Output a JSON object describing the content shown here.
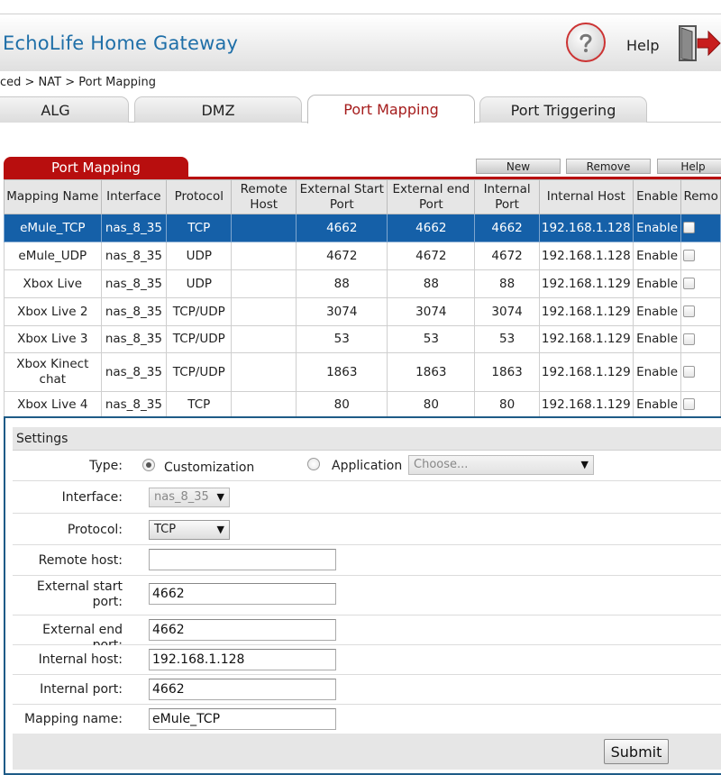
{
  "header": {
    "brand": "EchoLife Home Gateway",
    "help_label": "Help"
  },
  "breadcrumb": "ced > NAT > Port Mapping",
  "tabs": [
    {
      "label": "ALG",
      "active": false
    },
    {
      "label": "DMZ",
      "active": false
    },
    {
      "label": "Port Mapping",
      "active": true
    },
    {
      "label": "Port Triggering",
      "active": false
    }
  ],
  "section": {
    "title": "Port Mapping",
    "buttons": {
      "new": "New",
      "remove": "Remove",
      "help": "Help"
    }
  },
  "table": {
    "headers": {
      "mapping_name": "Mapping Name",
      "interface": "Interface",
      "protocol": "Protocol",
      "remote_host_1": "Remote",
      "remote_host_2": "Host",
      "ext_start_1": "External Start",
      "ext_start_2": "Port",
      "ext_end_1": "External end",
      "ext_end_2": "Port",
      "int_port_1": "Internal",
      "int_port_2": "Port",
      "internal_host": "Internal Host",
      "enable": "Enable",
      "remove": "Remo"
    },
    "rows": [
      {
        "name": "eMule_TCP",
        "iface": "nas_8_35",
        "proto": "TCP",
        "remote": "",
        "ext_start": "4662",
        "ext_end": "4662",
        "int_port": "4662",
        "host": "192.168.1.128",
        "enable": "Enable"
      },
      {
        "name": "eMule_UDP",
        "iface": "nas_8_35",
        "proto": "UDP",
        "remote": "",
        "ext_start": "4672",
        "ext_end": "4672",
        "int_port": "4672",
        "host": "192.168.1.128",
        "enable": "Enable"
      },
      {
        "name": "Xbox Live",
        "iface": "nas_8_35",
        "proto": "UDP",
        "remote": "",
        "ext_start": "88",
        "ext_end": "88",
        "int_port": "88",
        "host": "192.168.1.129",
        "enable": "Enable"
      },
      {
        "name": "Xbox Live 2",
        "iface": "nas_8_35",
        "proto": "TCP/UDP",
        "remote": "",
        "ext_start": "3074",
        "ext_end": "3074",
        "int_port": "3074",
        "host": "192.168.1.129",
        "enable": "Enable"
      },
      {
        "name": "Xbox Live 3",
        "iface": "nas_8_35",
        "proto": "TCP/UDP",
        "remote": "",
        "ext_start": "53",
        "ext_end": "53",
        "int_port": "53",
        "host": "192.168.1.129",
        "enable": "Enable"
      },
      {
        "name_1": "Xbox Kinect",
        "name_2": "chat",
        "iface": "nas_8_35",
        "proto": "TCP/UDP",
        "remote": "",
        "ext_start": "1863",
        "ext_end": "1863",
        "int_port": "1863",
        "host": "192.168.1.129",
        "enable": "Enable"
      },
      {
        "name": "Xbox Live 4",
        "iface": "nas_8_35",
        "proto": "TCP",
        "remote": "",
        "ext_start": "80",
        "ext_end": "80",
        "int_port": "80",
        "host": "192.168.1.129",
        "enable": "Enable"
      }
    ]
  },
  "settings": {
    "title": "Settings",
    "type_label": "Type:",
    "type_customization": "Customization",
    "type_application": "Application",
    "application_select": "Choose...",
    "interface_label": "Interface:",
    "interface_value": "nas_8_35",
    "protocol_label": "Protocol:",
    "protocol_value": "TCP",
    "remote_host_label": "Remote host:",
    "remote_host_value": "",
    "ext_start_label_1": "External start",
    "ext_start_label_2": "port:",
    "ext_start_value": "4662",
    "ext_end_label": "External end port:",
    "ext_end_value": "4662",
    "internal_host_label": "Internal host:",
    "internal_host_value": "192.168.1.128",
    "internal_port_label": "Internal port:",
    "internal_port_value": "4662",
    "mapping_name_label": "Mapping name:",
    "mapping_name_value": "eMule_TCP",
    "submit": "Submit"
  },
  "colors": {
    "brand": "#1f6fa8",
    "accent_red": "#b80e0e",
    "selected_row": "#1560a8"
  }
}
